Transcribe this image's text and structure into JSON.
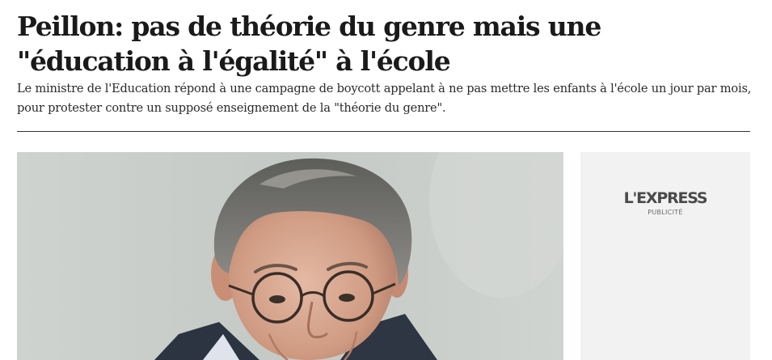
{
  "article": {
    "title": "Peillon: pas de théorie du genre mais une \"éducation à l'égalité\" à l'école",
    "lead": "Le ministre de l'Education répond à une campagne de boycott appelant à ne pas mettre les enfants à l'école un jour par mois, pour protester contre un supposé enseignement de la \"théorie du genre\"."
  },
  "ad": {
    "logo": "L'EXPRESS",
    "label": "PUBLICITÉ",
    "background": "#f2f2f2"
  },
  "colors": {
    "text": "#1a1a1a",
    "rule": "#333333"
  }
}
